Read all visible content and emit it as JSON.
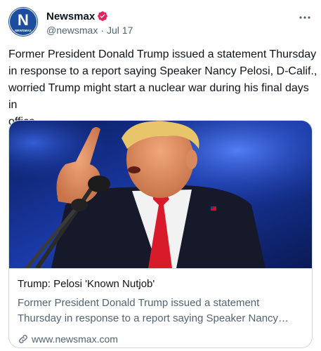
{
  "author": {
    "display_name": "Newsmax",
    "handle": "@newsmax",
    "separator": "·",
    "date": "Jul 17",
    "avatar_letter": "N",
    "avatar_wordmark": "NEWSMAX",
    "verified_icon": "verified-badge-icon",
    "verified_color": "#e0245e"
  },
  "tweet": {
    "line1": "Former President Donald Trump issued a statement Thursday",
    "line2": "in response to a report saying Speaker Nancy Pelosi, D-Calif.,",
    "line3": "worried Trump might start a nuclear war during his final days in",
    "line4": "office."
  },
  "card": {
    "title": "Trump: Pelosi 'Known Nutjob'",
    "description": "Former President Donald Trump issued a statement Thursday in response to a report saying Speaker Nancy…",
    "domain": "www.newsmax.com",
    "domain_icon": "link-icon"
  },
  "colors": {
    "text": "#0f1419",
    "secondary": "#536471",
    "border": "#cfd9de",
    "brand_blue": "#1d4e9e"
  }
}
